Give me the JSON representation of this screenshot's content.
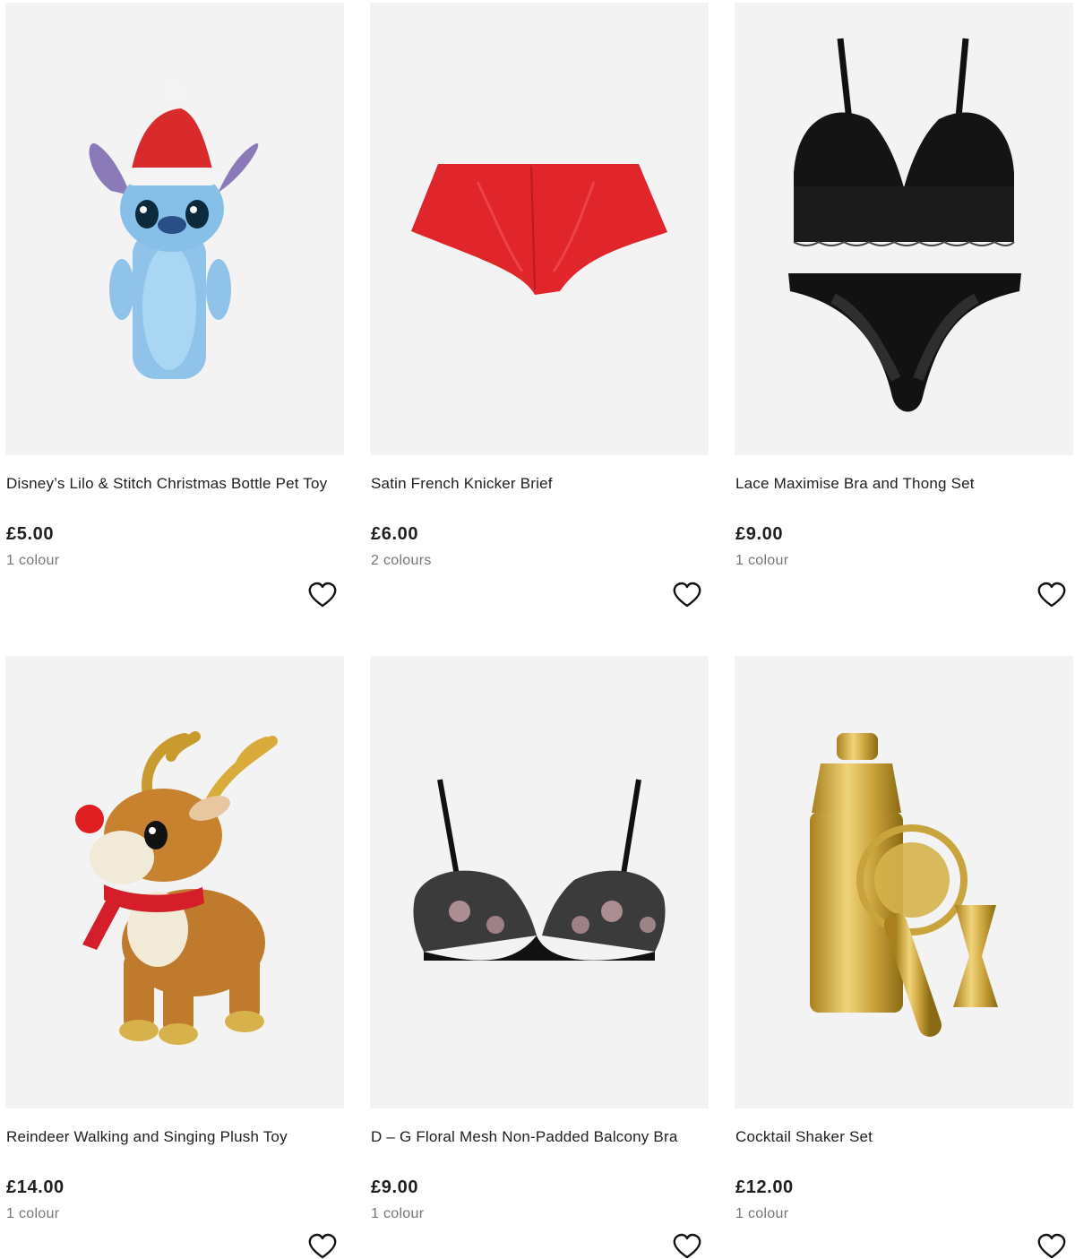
{
  "products": [
    {
      "title": "Disney’s Lilo & Stitch Christmas Bottle Pet Toy",
      "price": "£5.00",
      "colours": "1 colour",
      "image_icon": "stitch-plush-image"
    },
    {
      "title": "Satin French Knicker Brief",
      "price": "£6.00",
      "colours": "2 colours",
      "image_icon": "red-satin-knicker-image"
    },
    {
      "title": "Lace Maximise Bra and Thong Set",
      "price": "£9.00",
      "colours": "1 colour",
      "image_icon": "black-lace-set-image"
    },
    {
      "title": "Reindeer Walking and Singing Plush Toy",
      "price": "£14.00",
      "colours": "1 colour",
      "image_icon": "reindeer-plush-image"
    },
    {
      "title": "D – G Floral Mesh Non-Padded Balcony Bra",
      "price": "£9.00",
      "colours": "1 colour",
      "image_icon": "floral-bra-image"
    },
    {
      "title": "Cocktail Shaker Set",
      "price": "£12.00",
      "colours": "1 colour",
      "image_icon": "gold-cocktail-set-image"
    }
  ],
  "colors": {
    "tile_bg": "#f3f3f3",
    "text": "#1e1e1e",
    "muted": "#777777"
  }
}
